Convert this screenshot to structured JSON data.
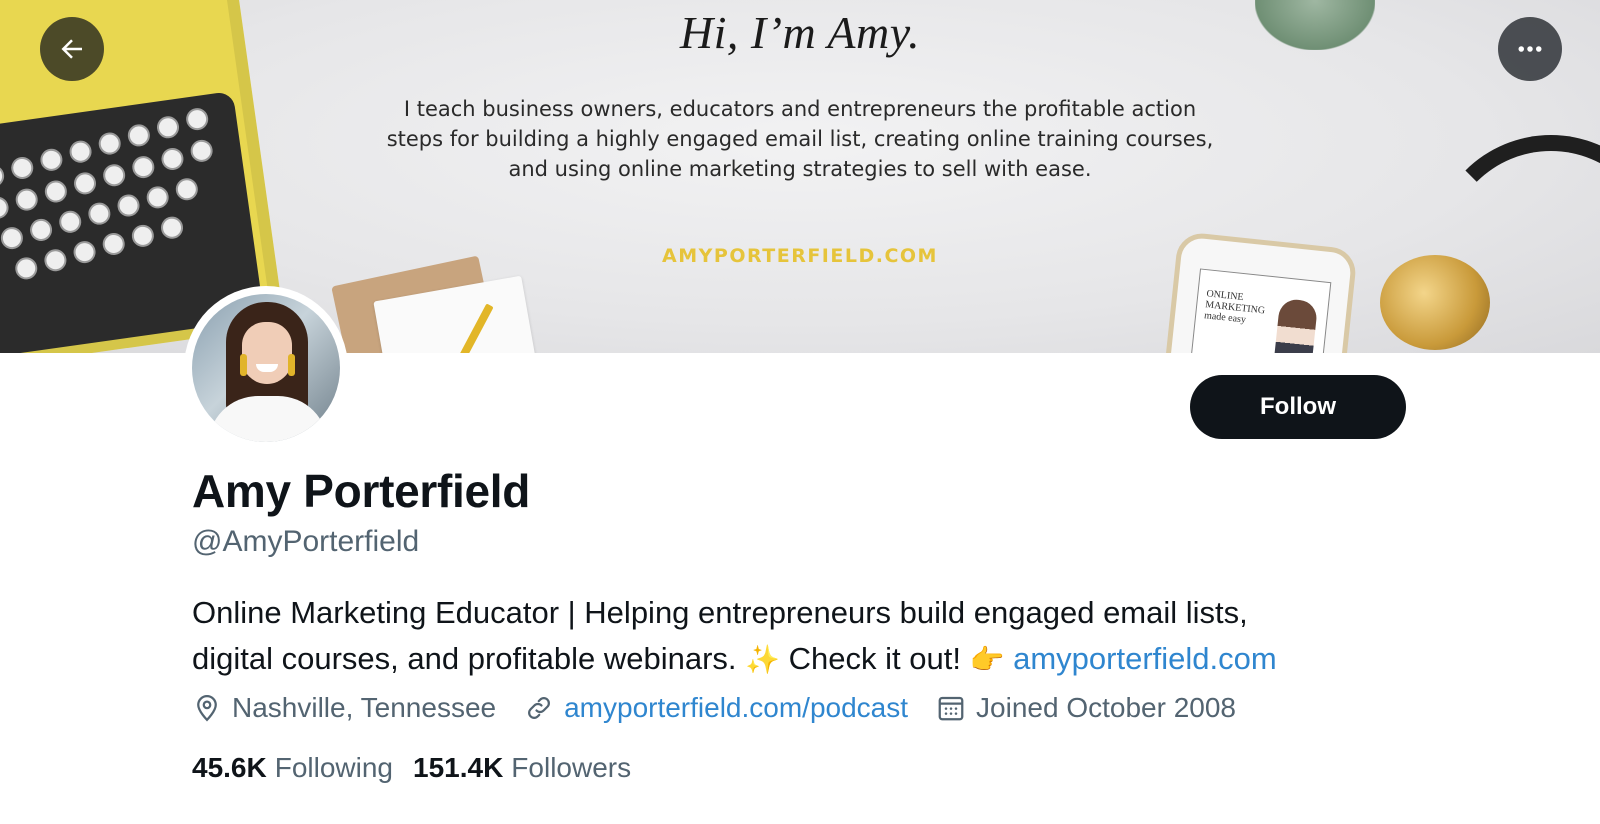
{
  "banner": {
    "title": "Hi, I’m Amy.",
    "text_lines": [
      "I teach business owners, educators and entrepreneurs the profitable action",
      "steps for building a highly engaged email list, creating online training courses,",
      "and using online marketing strategies to sell with ease."
    ],
    "site": "AMYPORTERFIELD.COM",
    "phone_text": "ONLINE MARKETING made easy"
  },
  "header": {
    "back_icon": "arrow-left-icon",
    "more_icon": "ellipsis-icon"
  },
  "profile": {
    "name": "Amy Porterfield",
    "handle": "@AmyPorterfield",
    "follow_label": "Follow",
    "bio": {
      "line1": "Online Marketing Educator | Helping entrepreneurs build engaged email lists,",
      "line2_text": "digital courses, and profitable webinars.",
      "sparkles": "✨",
      "cta": "Check it out!",
      "pointing": "👉",
      "link": "amyporterfield.com"
    },
    "meta": {
      "location": "Nashville, Tennessee",
      "website": "amyporterfield.com/podcast",
      "joined": "Joined October 2008"
    },
    "stats": {
      "following_count": "45.6K",
      "following_label": "Following",
      "followers_count": "151.4K",
      "followers_label": "Followers"
    }
  },
  "colors": {
    "text_primary": "#0f1419",
    "text_secondary": "#536471",
    "link": "#2f86cf",
    "follow_bg": "#0f1419",
    "banner_site": "#e6c43b"
  }
}
